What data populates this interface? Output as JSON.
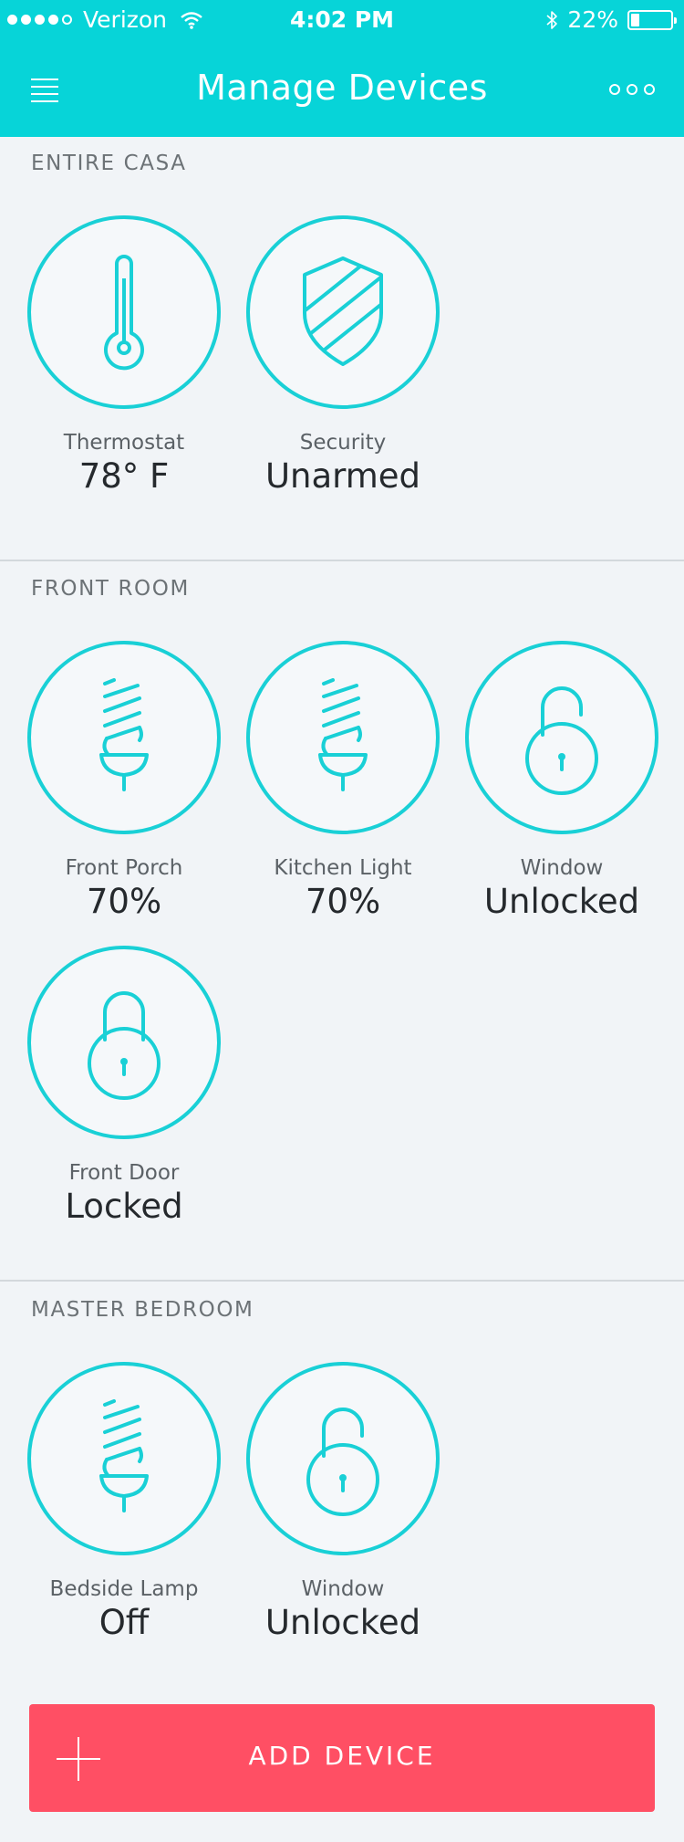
{
  "status_bar": {
    "carrier": "Verizon",
    "time": "4:02 PM",
    "battery": "22%",
    "battery_level": 0.22,
    "signal_bars_filled": 4,
    "signal_bars_total": 5
  },
  "header": {
    "title": "Manage Devices",
    "menu_icon": "hamburger-menu-icon",
    "more_icon": "more-options-icon"
  },
  "colors": {
    "accent": "#07d4d8",
    "circle_stroke": "#19d0d6",
    "button": "#ff4f64",
    "background": "#f1f4f7"
  },
  "sections": [
    {
      "title": "ENTIRE CASA",
      "devices": [
        {
          "label": "Thermostat",
          "value": "78° F",
          "icon": "thermometer-icon"
        },
        {
          "label": "Security",
          "value": "Unarmed",
          "icon": "shield-icon"
        }
      ]
    },
    {
      "title": "FRONT ROOM",
      "devices": [
        {
          "label": "Front Porch",
          "value": "70%",
          "icon": "light-bulb-icon"
        },
        {
          "label": "Kitchen Light",
          "value": "70%",
          "icon": "light-bulb-icon"
        },
        {
          "label": "Window",
          "value": "Unlocked",
          "icon": "unlocked-padlock-icon"
        },
        {
          "label": "Front Door",
          "value": "Locked",
          "icon": "locked-padlock-icon"
        }
      ]
    },
    {
      "title": "MASTER BEDROOM",
      "devices": [
        {
          "label": "Bedside Lamp",
          "value": "Off",
          "icon": "light-bulb-icon"
        },
        {
          "label": "Window",
          "value": "Unlocked",
          "icon": "unlocked-padlock-icon"
        }
      ]
    }
  ],
  "add_button": {
    "label": "ADD DEVICE",
    "icon": "plus-icon"
  }
}
